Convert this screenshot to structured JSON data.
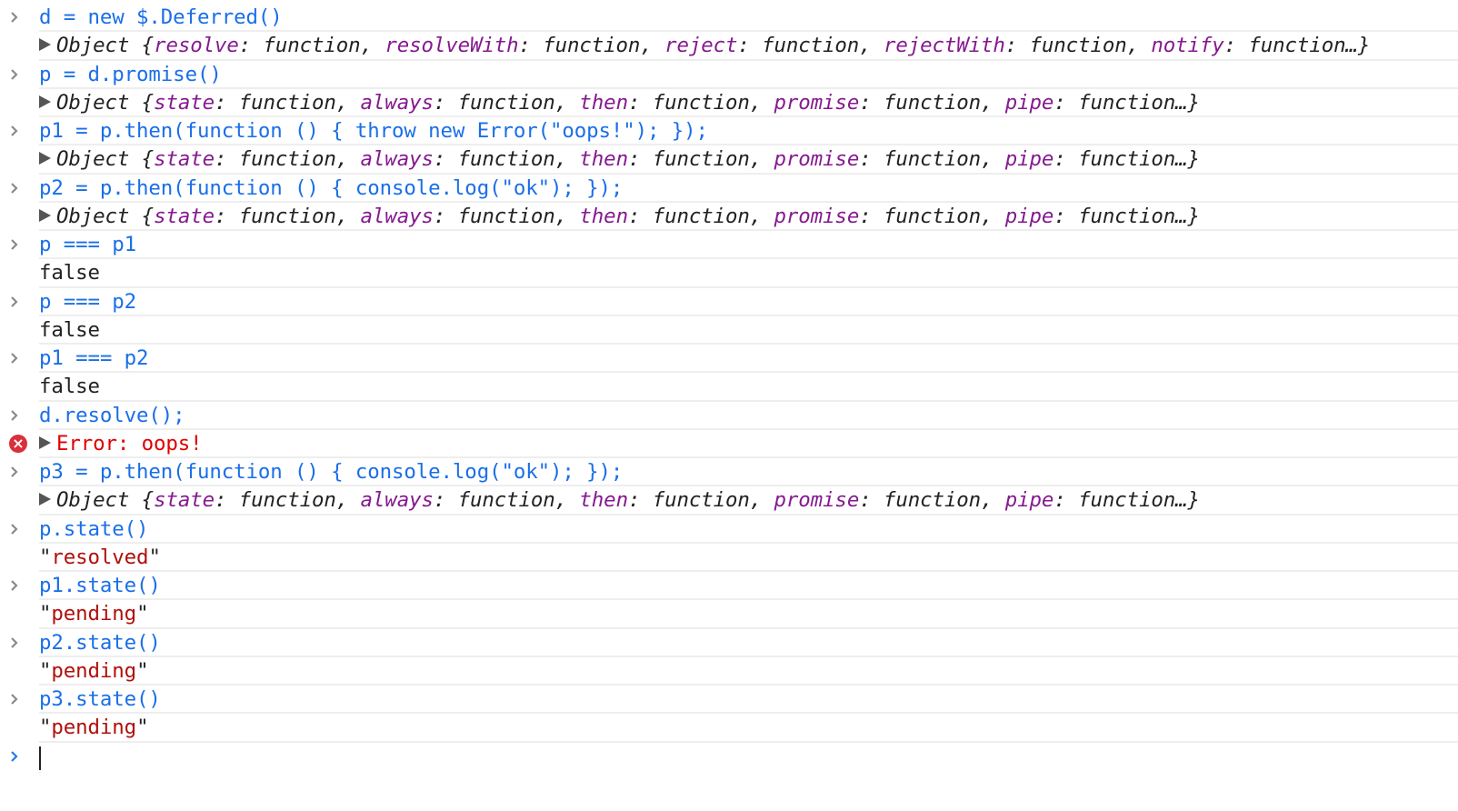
{
  "console": {
    "entries": [
      {
        "type": "input",
        "text": "d = new $.Deferred()"
      },
      {
        "type": "object",
        "label": "Object",
        "props": [
          {
            "key": "resolve",
            "value": "function"
          },
          {
            "key": "resolveWith",
            "value": "function"
          },
          {
            "key": "reject",
            "value": "function"
          },
          {
            "key": "rejectWith",
            "value": "function"
          },
          {
            "key": "notify",
            "value": "function…"
          }
        ]
      },
      {
        "type": "input",
        "text": "p = d.promise()"
      },
      {
        "type": "object",
        "label": "Object",
        "props": [
          {
            "key": "state",
            "value": "function"
          },
          {
            "key": "always",
            "value": "function"
          },
          {
            "key": "then",
            "value": "function"
          },
          {
            "key": "promise",
            "value": "function"
          },
          {
            "key": "pipe",
            "value": "function…"
          }
        ]
      },
      {
        "type": "input",
        "text": "p1 = p.then(function () { throw new Error(\"oops!\"); });"
      },
      {
        "type": "object",
        "label": "Object",
        "props": [
          {
            "key": "state",
            "value": "function"
          },
          {
            "key": "always",
            "value": "function"
          },
          {
            "key": "then",
            "value": "function"
          },
          {
            "key": "promise",
            "value": "function"
          },
          {
            "key": "pipe",
            "value": "function…"
          }
        ]
      },
      {
        "type": "input",
        "text": "p2 = p.then(function () { console.log(\"ok\"); });"
      },
      {
        "type": "object",
        "label": "Object",
        "props": [
          {
            "key": "state",
            "value": "function"
          },
          {
            "key": "always",
            "value": "function"
          },
          {
            "key": "then",
            "value": "function"
          },
          {
            "key": "promise",
            "value": "function"
          },
          {
            "key": "pipe",
            "value": "function…"
          }
        ]
      },
      {
        "type": "input",
        "text": "p === p1"
      },
      {
        "type": "value",
        "text": "false"
      },
      {
        "type": "input",
        "text": "p === p2"
      },
      {
        "type": "value",
        "text": "false"
      },
      {
        "type": "input",
        "text": "p1 === p2"
      },
      {
        "type": "value",
        "text": "false"
      },
      {
        "type": "input",
        "text": "d.resolve();"
      },
      {
        "type": "error",
        "text": "Error: oops!"
      },
      {
        "type": "input",
        "text": "p3 = p.then(function () { console.log(\"ok\"); });"
      },
      {
        "type": "object",
        "label": "Object",
        "props": [
          {
            "key": "state",
            "value": "function"
          },
          {
            "key": "always",
            "value": "function"
          },
          {
            "key": "then",
            "value": "function"
          },
          {
            "key": "promise",
            "value": "function"
          },
          {
            "key": "pipe",
            "value": "function…"
          }
        ]
      },
      {
        "type": "input",
        "text": "p.state()"
      },
      {
        "type": "string",
        "text": "resolved"
      },
      {
        "type": "input",
        "text": "p1.state()"
      },
      {
        "type": "string",
        "text": "pending"
      },
      {
        "type": "input",
        "text": "p2.state()"
      },
      {
        "type": "string",
        "text": "pending"
      },
      {
        "type": "input",
        "text": "p3.state()"
      },
      {
        "type": "string",
        "text": "pending"
      }
    ],
    "prompt": {
      "value": ""
    }
  },
  "colors": {
    "input": "#1a6fe8",
    "key": "#851a8f",
    "error": "#e00000",
    "string": "#b0100c",
    "error_icon": "#d9303a"
  }
}
